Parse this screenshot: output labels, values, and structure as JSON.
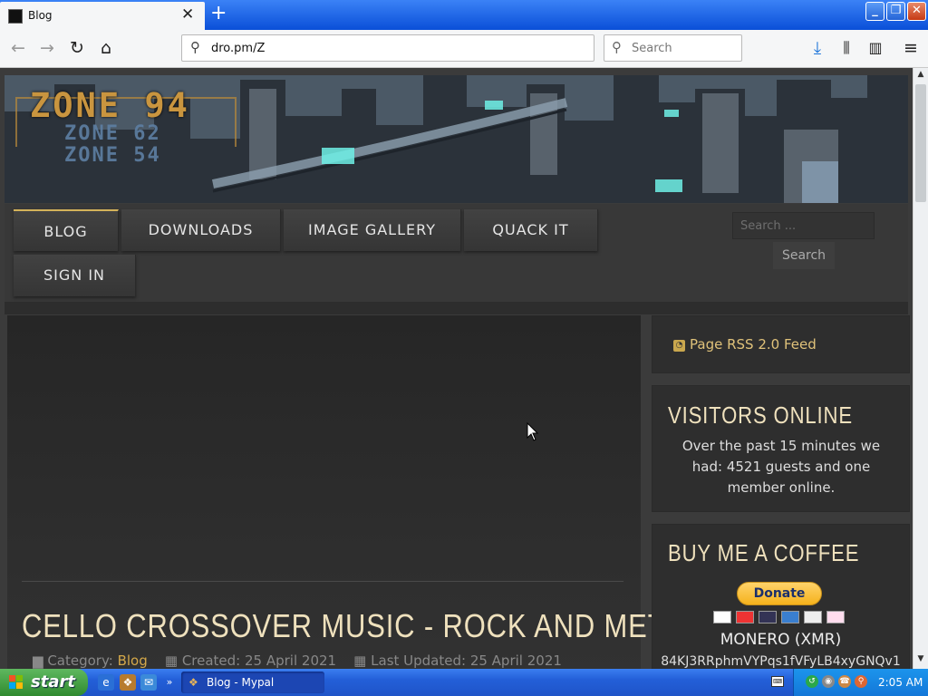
{
  "browser": {
    "tab_title": "Blog",
    "tab_close": "✕",
    "new_tab": "+",
    "url": "dro.pm/Z",
    "search_placeholder": "Search",
    "icons": [
      "back-icon",
      "forward-icon",
      "reload-icon",
      "home-icon",
      "download-icon",
      "library-icon",
      "sidebar-icon",
      "menu-icon"
    ]
  },
  "window_controls": {
    "minimize": "_",
    "restore": "❐",
    "close": "✕"
  },
  "site": {
    "logo_main": "ZONE 94",
    "logo_sub1": "ZONE 62",
    "logo_sub2": "ZONE 54",
    "menu": [
      "BLOG",
      "DOWNLOADS",
      "IMAGE GALLERY",
      "QUACK IT",
      "SIGN IN"
    ],
    "search_placeholder": "Search ...",
    "search_button": "Search"
  },
  "article": {
    "title": "CELLO CROSSOVER MUSIC - ROCK AND METAL",
    "category_label": "Category:",
    "category": "Blog",
    "created": "Created: 25 April 2021",
    "updated": "Last Updated: 25 April 2021"
  },
  "sidebar": {
    "rss": "Page RSS 2.0 Feed",
    "visitors_title": "VISITORS ONLINE",
    "visitors_text": "Over the past 15 minutes we had: 4521 guests and one member online.",
    "coffee_title": "BUY ME A COFFEE",
    "donate": "Donate",
    "xmr_label": "MONERO (XMR)",
    "xmr_address": "84KJ3RRphmVYPqs1fVFyLB4xyGNQv1"
  },
  "taskbar": {
    "start": "start",
    "task_button": "Blog - Mypal",
    "clock": "2:05 AM"
  },
  "colors": {
    "accent": "#d4b25a",
    "title": "#efe1bd",
    "taskbar": "#235fd8"
  }
}
